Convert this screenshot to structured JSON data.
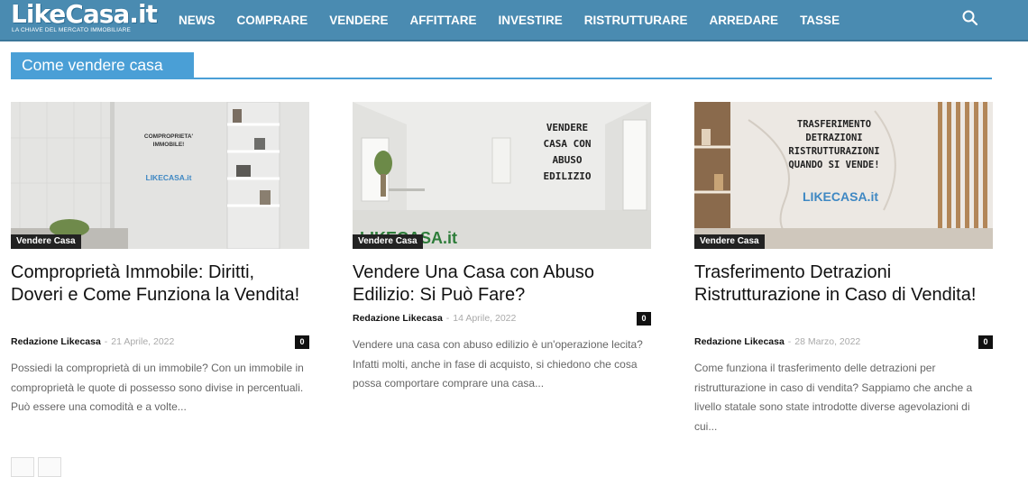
{
  "header": {
    "logo_text": "LikeCasa.it",
    "logo_tagline": "LA CHIAVE DEL MERCATO IMMOBILIARE",
    "nav": [
      "NEWS",
      "COMPRARE",
      "VENDERE",
      "AFFITTARE",
      "INVESTIRE",
      "RISTRUTTURARE",
      "ARREDARE",
      "TASSE"
    ],
    "search_icon": "search-icon"
  },
  "section": {
    "title": "Come vendere casa"
  },
  "colors": {
    "nav_bg": "#4a8bb1",
    "accent": "#4a9fd6",
    "badge_bg": "#222222"
  },
  "articles": [
    {
      "image_text": [
        "COMPROPRIETA'",
        "IMMOBILE!",
        "LIKECASA.it"
      ],
      "category": "Vendere Casa",
      "title": "Comproprietà Immobile: Diritti, Doveri e Come Funziona la Vendita!",
      "author": "Redazione Likecasa",
      "separator": "-",
      "date": "21 Aprile, 2022",
      "comments": "0",
      "excerpt": "Possiedi la comproprietà di un immobile? Con un immobile in comproprietà le quote di possesso sono divise in percentuali. Può essere una comodità e a volte..."
    },
    {
      "image_text": [
        "VENDERE",
        "CASA CON",
        "ABUSO",
        "EDILIZIO",
        "LIKECASA.it"
      ],
      "category": "Vendere Casa",
      "title": "Vendere Una Casa con Abuso Edilizio: Si Può Fare?",
      "author": "Redazione Likecasa",
      "separator": "-",
      "date": "14 Aprile, 2022",
      "comments": "0",
      "excerpt": "Vendere una casa con abuso edilizio è un'operazione lecita? Infatti molti, anche in fase di acquisto, si chiedono che cosa possa comportare comprare una casa..."
    },
    {
      "image_text": [
        "TRASFERIMENTO",
        "DETRAZIONI",
        "RISTRUTTURAZIONI",
        "QUANDO SI VENDE!",
        "LIKECASA.it"
      ],
      "category": "Vendere Casa",
      "title": "Trasferimento Detrazioni Ristrutturazione in Caso di Vendita!",
      "author": "Redazione Likecasa",
      "separator": "-",
      "date": "28 Marzo, 2022",
      "comments": "0",
      "excerpt": "Come funziona il trasferimento delle detrazioni per ristrutturazione in caso di vendita? Sappiamo che anche a livello statale sono state introdotte diverse agevolazioni di cui..."
    }
  ]
}
